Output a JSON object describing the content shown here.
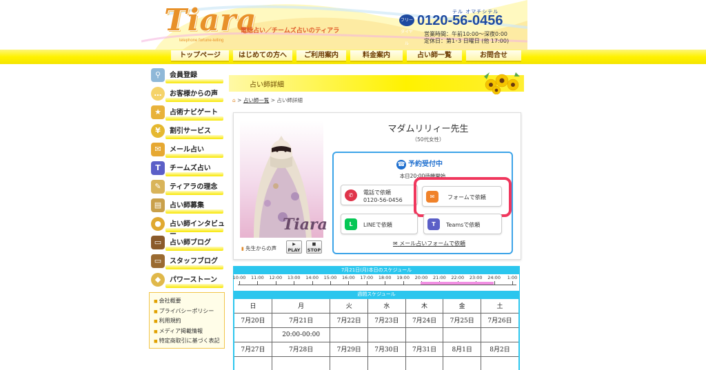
{
  "header": {
    "logo": "Tiara",
    "logo_sub": "telephone fortune-telling",
    "tagline": "電話占い／チームズ占いのティアラ",
    "phone_icon": "フリーダイヤル",
    "phone_ruby": "テル オマチシテル",
    "phone": "0120-56-0456",
    "hours_line1": "営業時間：午前10:00～深夜0:00",
    "hours_line2": "定休日：第1･3 日曜日 (他 17:00)"
  },
  "nav": [
    "トップページ",
    "はじめての方へ",
    "ご利用案内",
    "料金案内",
    "占い師一覧",
    "お問合せ"
  ],
  "sidebar": {
    "items": [
      {
        "label": "会員登録",
        "icon": "magnifier-icon",
        "color": "#8fb8d8"
      },
      {
        "label": "お客様からの声",
        "icon": "speech-bubble-icon",
        "color": "#f5d36a"
      },
      {
        "label": "占術ナビゲート",
        "icon": "star-icon",
        "color": "#e8b23a"
      },
      {
        "label": "割引サービス",
        "icon": "yen-coin-icon",
        "color": "#e5b830"
      },
      {
        "label": "メール占い",
        "icon": "envelope-icon",
        "color": "#e6a832"
      },
      {
        "label": "チームズ占い",
        "icon": "teams-icon",
        "color": "#5b5fc7"
      },
      {
        "label": "ティアラの理念",
        "icon": "quill-icon",
        "color": "#d9b45a"
      },
      {
        "label": "占い師募集",
        "icon": "book-icon",
        "color": "#c9a04a"
      },
      {
        "label": "占い師インタビュー",
        "icon": "microphone-icon",
        "color": "#e0a930"
      },
      {
        "label": "占い師ブログ",
        "icon": "laptop-icon",
        "color": "#8a5a2a"
      },
      {
        "label": "スタッフブログ",
        "icon": "laptop-icon",
        "color": "#9a6a30"
      },
      {
        "label": "パワーストーン",
        "icon": "gem-icon",
        "color": "#e0b84a"
      }
    ],
    "links": [
      "会社概要",
      "プライバシーポリシー",
      "利用規約",
      "メディア掲載情報",
      "特定商取引に基づく表記"
    ]
  },
  "section_title": "占い師詳細",
  "breadcrumb": {
    "link": "占い師一覧",
    "current": "占い師詳細"
  },
  "profile": {
    "name": "マダムリリィー先生",
    "age": "（50代女性）",
    "photo_watermark": "Tiara",
    "voice_label": "先生からの声",
    "play": "PLAY",
    "stop": "STOP"
  },
  "booking": {
    "title": "予約受付中",
    "subtitle": "本日20:00待機開始",
    "phone_label": "電話で依頼",
    "phone_number": "0120-56-0456",
    "form_label": "フォームで依頼",
    "line_label": "LINEで依頼",
    "teams_label": "Teamsで依頼",
    "mail_link": "メール占いフォームで依頼"
  },
  "day_schedule": {
    "title": "7月21日(月)本日のスケジュール",
    "ticks": [
      "10:00",
      "11:00",
      "12:00",
      "13:00",
      "14:00",
      "15:00",
      "16:00",
      "17:00",
      "18:00",
      "19:00",
      "20:00",
      "21:00",
      "22:00",
      "23:00",
      "24:00",
      "1:00"
    ],
    "available_from": "20:00",
    "available_to": "24:00"
  },
  "week_schedule": {
    "title": "週間スケジュール",
    "days": [
      "日",
      "月",
      "火",
      "水",
      "木",
      "金",
      "土"
    ],
    "week1_dates": [
      "7月20日",
      "7月21日",
      "7月22日",
      "7月23日",
      "7月24日",
      "7月25日",
      "7月26日"
    ],
    "week1_slots": [
      "",
      "20:00-00:00",
      "",
      "",
      "",
      "",
      ""
    ],
    "week2_dates": [
      "7月27日",
      "7月28日",
      "7月29日",
      "7月30日",
      "7月31日",
      "8月1日",
      "8月2日"
    ],
    "week2_slots": [
      "",
      "",
      "",
      "",
      "",
      "",
      ""
    ]
  },
  "colors": {
    "accent_yellow": "#fff200",
    "brand_orange": "#e8912a",
    "booking_blue": "#3ba3e8",
    "highlight_red": "#f0375d",
    "schedule_cyan": "#2bc6ee"
  }
}
